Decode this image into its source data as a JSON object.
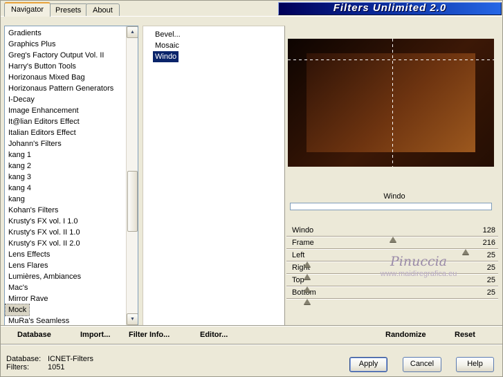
{
  "window": {
    "title": "Filters Unlimited 2.0"
  },
  "tabs": [
    {
      "label": "Navigator",
      "active": true
    },
    {
      "label": "Presets",
      "active": false
    },
    {
      "label": "About",
      "active": false
    }
  ],
  "icons": {
    "scroll_up": "▲",
    "scroll_down": "▼"
  },
  "category_list": {
    "selected": "Mock",
    "items": [
      "Gradients",
      "Graphics Plus",
      "Greg's Factory Output Vol. II",
      "Harry's Button Tools",
      "Horizonaus Mixed Bag",
      "Horizonaus Pattern Generators",
      "I-Decay",
      "Image Enhancement",
      "It@lian Editors Effect",
      "Italian Editors Effect",
      "Johann's Filters",
      "kang 1",
      "kang 2",
      "kang 3",
      "kang 4",
      "kang",
      "Kohan's Filters",
      "Krusty's FX vol. I 1.0",
      "Krusty's FX vol. II 1.0",
      "Krusty's FX vol. II 2.0",
      "Lens Effects",
      "Lens Flares",
      "Lumières, Ambiances",
      "Mac's",
      "Mirror Rave",
      "Mock",
      "MuRa's Seamless"
    ]
  },
  "filter_list": {
    "selected": "Windo",
    "items": [
      "Bevel...",
      "Mosaic",
      "Windo"
    ]
  },
  "preview": {
    "filter_name": "Windo"
  },
  "sliders": [
    {
      "label": "Windo",
      "value": 128,
      "max": 255
    },
    {
      "label": "Frame",
      "value": 216,
      "max": 255
    },
    {
      "label": "Left",
      "value": 25,
      "max": 255
    },
    {
      "label": "Right",
      "value": 25,
      "max": 255
    },
    {
      "label": "Top",
      "value": 25,
      "max": 255
    },
    {
      "label": "Bottom",
      "value": 25,
      "max": 255
    }
  ],
  "watermark": {
    "line1": "Pinuccia",
    "line2": "www.maidiregrafica.eu"
  },
  "toolbar": {
    "database": "Database",
    "import": "Import...",
    "filter_info": "Filter Info...",
    "editor": "Editor...",
    "randomize": "Randomize",
    "reset": "Reset"
  },
  "status": {
    "database_label": "Database:",
    "database_value": "ICNET-Filters",
    "filters_label": "Filters:",
    "filters_value": "1051"
  },
  "buttons": {
    "apply": "Apply",
    "cancel": "Cancel",
    "help": "Help"
  },
  "colors": {
    "background": "#ece9d8",
    "selection": "#0a246a",
    "titlebar_start": "#000058",
    "titlebar_end": "#2667e6",
    "preview_outer": "#3c1806",
    "preview_inner": "#6e3410",
    "watermark": "#9a8aa8"
  }
}
